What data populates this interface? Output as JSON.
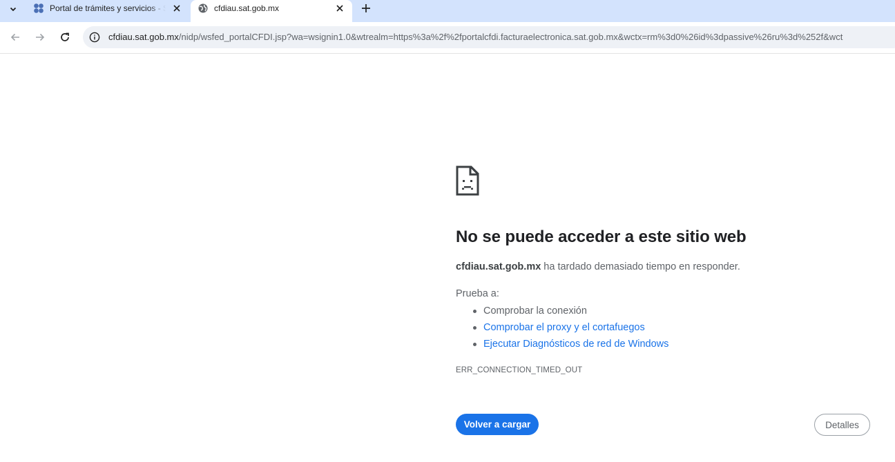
{
  "tabs": [
    {
      "title": "Portal de trámites y servicios - SAT",
      "active": false
    },
    {
      "title": "cfdiau.sat.gob.mx",
      "active": true
    }
  ],
  "address_bar": {
    "host": "cfdiau.sat.gob.mx",
    "path": "/nidp/wsfed_portalCFDI.jsp?wa=wsignin1.0&wtrealm=https%3a%2f%2fportalcfdi.facturaelectronica.sat.gob.mx&wctx=rm%3d0%26id%3dpassive%26ru%3d%252f&wct"
  },
  "error": {
    "heading": "No se puede acceder a este sitio web",
    "host": "cfdiau.sat.gob.mx",
    "message": " ha tardado demasiado tiempo en responder.",
    "try_label": "Prueba a:",
    "suggestions": [
      "Comprobar la conexión",
      "Comprobar el proxy y el cortafuegos",
      "Ejecutar Diagnósticos de red de Windows"
    ],
    "code": "ERR_CONNECTION_TIMED_OUT"
  },
  "buttons": {
    "reload": "Volver a cargar",
    "details": "Detalles"
  },
  "colors": {
    "tabstrip": "#d3e3fd",
    "accent": "#1a73e8",
    "omnibox": "#eef1f6"
  }
}
